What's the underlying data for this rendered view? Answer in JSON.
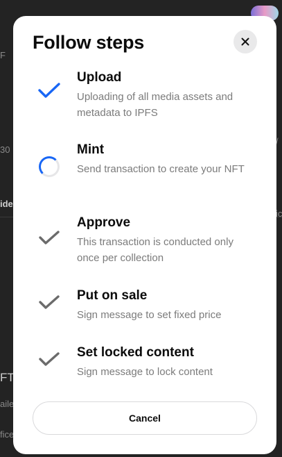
{
  "background": {
    "fragments": [
      "F",
      "30",
      "ide",
      "ic",
      "/",
      "FT",
      "aile",
      "fice"
    ]
  },
  "modal": {
    "title": "Follow steps",
    "close_icon": "close-icon",
    "steps": [
      {
        "title": "Upload",
        "description": "Uploading of all media assets and metadata to IPFS",
        "status": "done",
        "icon": "check-icon",
        "color": "#1866f5"
      },
      {
        "title": "Mint",
        "description": "Send transaction to create your NFT",
        "status": "in-progress",
        "icon": "spinner-icon",
        "color": "#1866f5"
      },
      {
        "title": "Approve",
        "description": "This transaction is conducted only once per collection",
        "status": "pending",
        "icon": "check-icon",
        "color": "#6b6b6b"
      },
      {
        "title": "Put on sale",
        "description": "Sign message to set fixed price",
        "status": "pending",
        "icon": "check-icon",
        "color": "#6b6b6b"
      },
      {
        "title": "Set locked content",
        "description": "Sign message to lock content",
        "status": "pending",
        "icon": "check-icon",
        "color": "#6b6b6b"
      }
    ],
    "cancel_label": "Cancel"
  }
}
